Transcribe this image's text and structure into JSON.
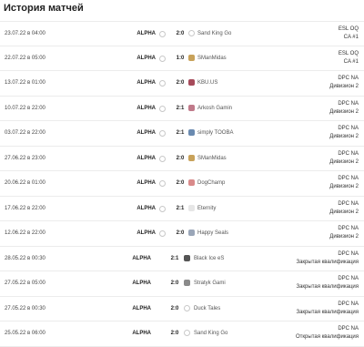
{
  "page": {
    "title": "История матчей"
  },
  "matches": [
    {
      "date": "23.07.22 в 04:00",
      "team_a": "ALPHA",
      "score": "2:0",
      "team_b": "Sand King Go",
      "team_b_icon": "globe-icon",
      "event_line1": "ESL OQ",
      "event_line2": "CA #1",
      "logo_color": "#c9c9c9"
    },
    {
      "date": "22.07.22 в 05:00",
      "team_a": "ALPHA",
      "score": "1:0",
      "team_b": "SManMidas",
      "team_b_icon": "smanmidas-logo-icon",
      "event_line1": "ESL OQ",
      "event_line2": "CA #1",
      "logo_color": "#c8a25a"
    },
    {
      "date": "13.07.22 в 01:00",
      "team_a": "ALPHA",
      "score": "2:0",
      "team_b": "KBU.US",
      "team_b_icon": "kbu-logo-icon",
      "event_line1": "DPC NA",
      "event_line2": "Дивизион 2",
      "logo_color": "#a64a5a"
    },
    {
      "date": "10.07.22 в 22:00",
      "team_a": "ALPHA",
      "score": "2:1",
      "team_b": "Arkosh Gamin",
      "team_b_icon": "arkosh-logo-icon",
      "event_line1": "DPC NA",
      "event_line2": "Дивизион 2",
      "logo_color": "#c07a8a"
    },
    {
      "date": "03.07.22 в 22:00",
      "team_a": "ALPHA",
      "score": "2:1",
      "team_b": "simply TOOBA",
      "team_b_icon": "tooba-logo-icon",
      "event_line1": "DPC NA",
      "event_line2": "Дивизион 2",
      "logo_color": "#6a8ab0"
    },
    {
      "date": "27.06.22 в 23:00",
      "team_a": "ALPHA",
      "score": "2:0",
      "team_b": "SManMidas",
      "team_b_icon": "smanmidas-logo-icon",
      "event_line1": "DPC NA",
      "event_line2": "Дивизион 2",
      "logo_color": "#c8a25a"
    },
    {
      "date": "20.06.22 в 01:00",
      "team_a": "ALPHA",
      "score": "2:0",
      "team_b": "DogChamp",
      "team_b_icon": "dogchamp-logo-icon",
      "event_line1": "DPC NA",
      "event_line2": "Дивизион 2",
      "logo_color": "#d98a8a"
    },
    {
      "date": "17.06.22 в 22:00",
      "team_a": "ALPHA",
      "score": "2:1",
      "team_b": "Eternity",
      "team_b_icon": "eternity-logo-icon",
      "event_line1": "DPC NA",
      "event_line2": "Дивизион 2",
      "logo_color": "#e6e6e6"
    },
    {
      "date": "12.06.22 в 22:00",
      "team_a": "ALPHA",
      "score": "2:0",
      "team_b": "Happy Seals",
      "team_b_icon": "happy-seals-logo-icon",
      "event_line1": "DPC NA",
      "event_line2": "Дивизион 2",
      "logo_color": "#9aa6b8"
    },
    {
      "date": "28.05.22 в 00:30",
      "team_a": "ALPHA",
      "score": "2:1",
      "team_b": "Black Ice eS",
      "team_b_icon": "black-ice-logo-icon",
      "event_line1": "DPC NA",
      "event_line2": "Закрытая квалификация",
      "logo_color": "#555555"
    },
    {
      "date": "27.05.22 в 05:00",
      "team_a": "ALPHA",
      "score": "2:0",
      "team_b": "Stratyk Gami",
      "team_b_icon": "stratyk-logo-icon",
      "event_line1": "DPC NA",
      "event_line2": "Закрытая квалификация",
      "logo_color": "#8a8a8a"
    },
    {
      "date": "27.05.22 в 00:30",
      "team_a": "ALPHA",
      "score": "2:0",
      "team_b": "Duck Tales",
      "team_b_icon": "globe-icon",
      "event_line1": "DPC NA",
      "event_line2": "Закрытая квалификация",
      "logo_color": "#c9c9c9"
    },
    {
      "date": "25.05.22 в 06:00",
      "team_a": "ALPHA",
      "score": "2:0",
      "team_b": "Sand King Go",
      "team_b_icon": "globe-icon",
      "event_line1": "DPC NA",
      "event_line2": "Открытая квалификация",
      "logo_color": "#c9c9c9"
    }
  ]
}
